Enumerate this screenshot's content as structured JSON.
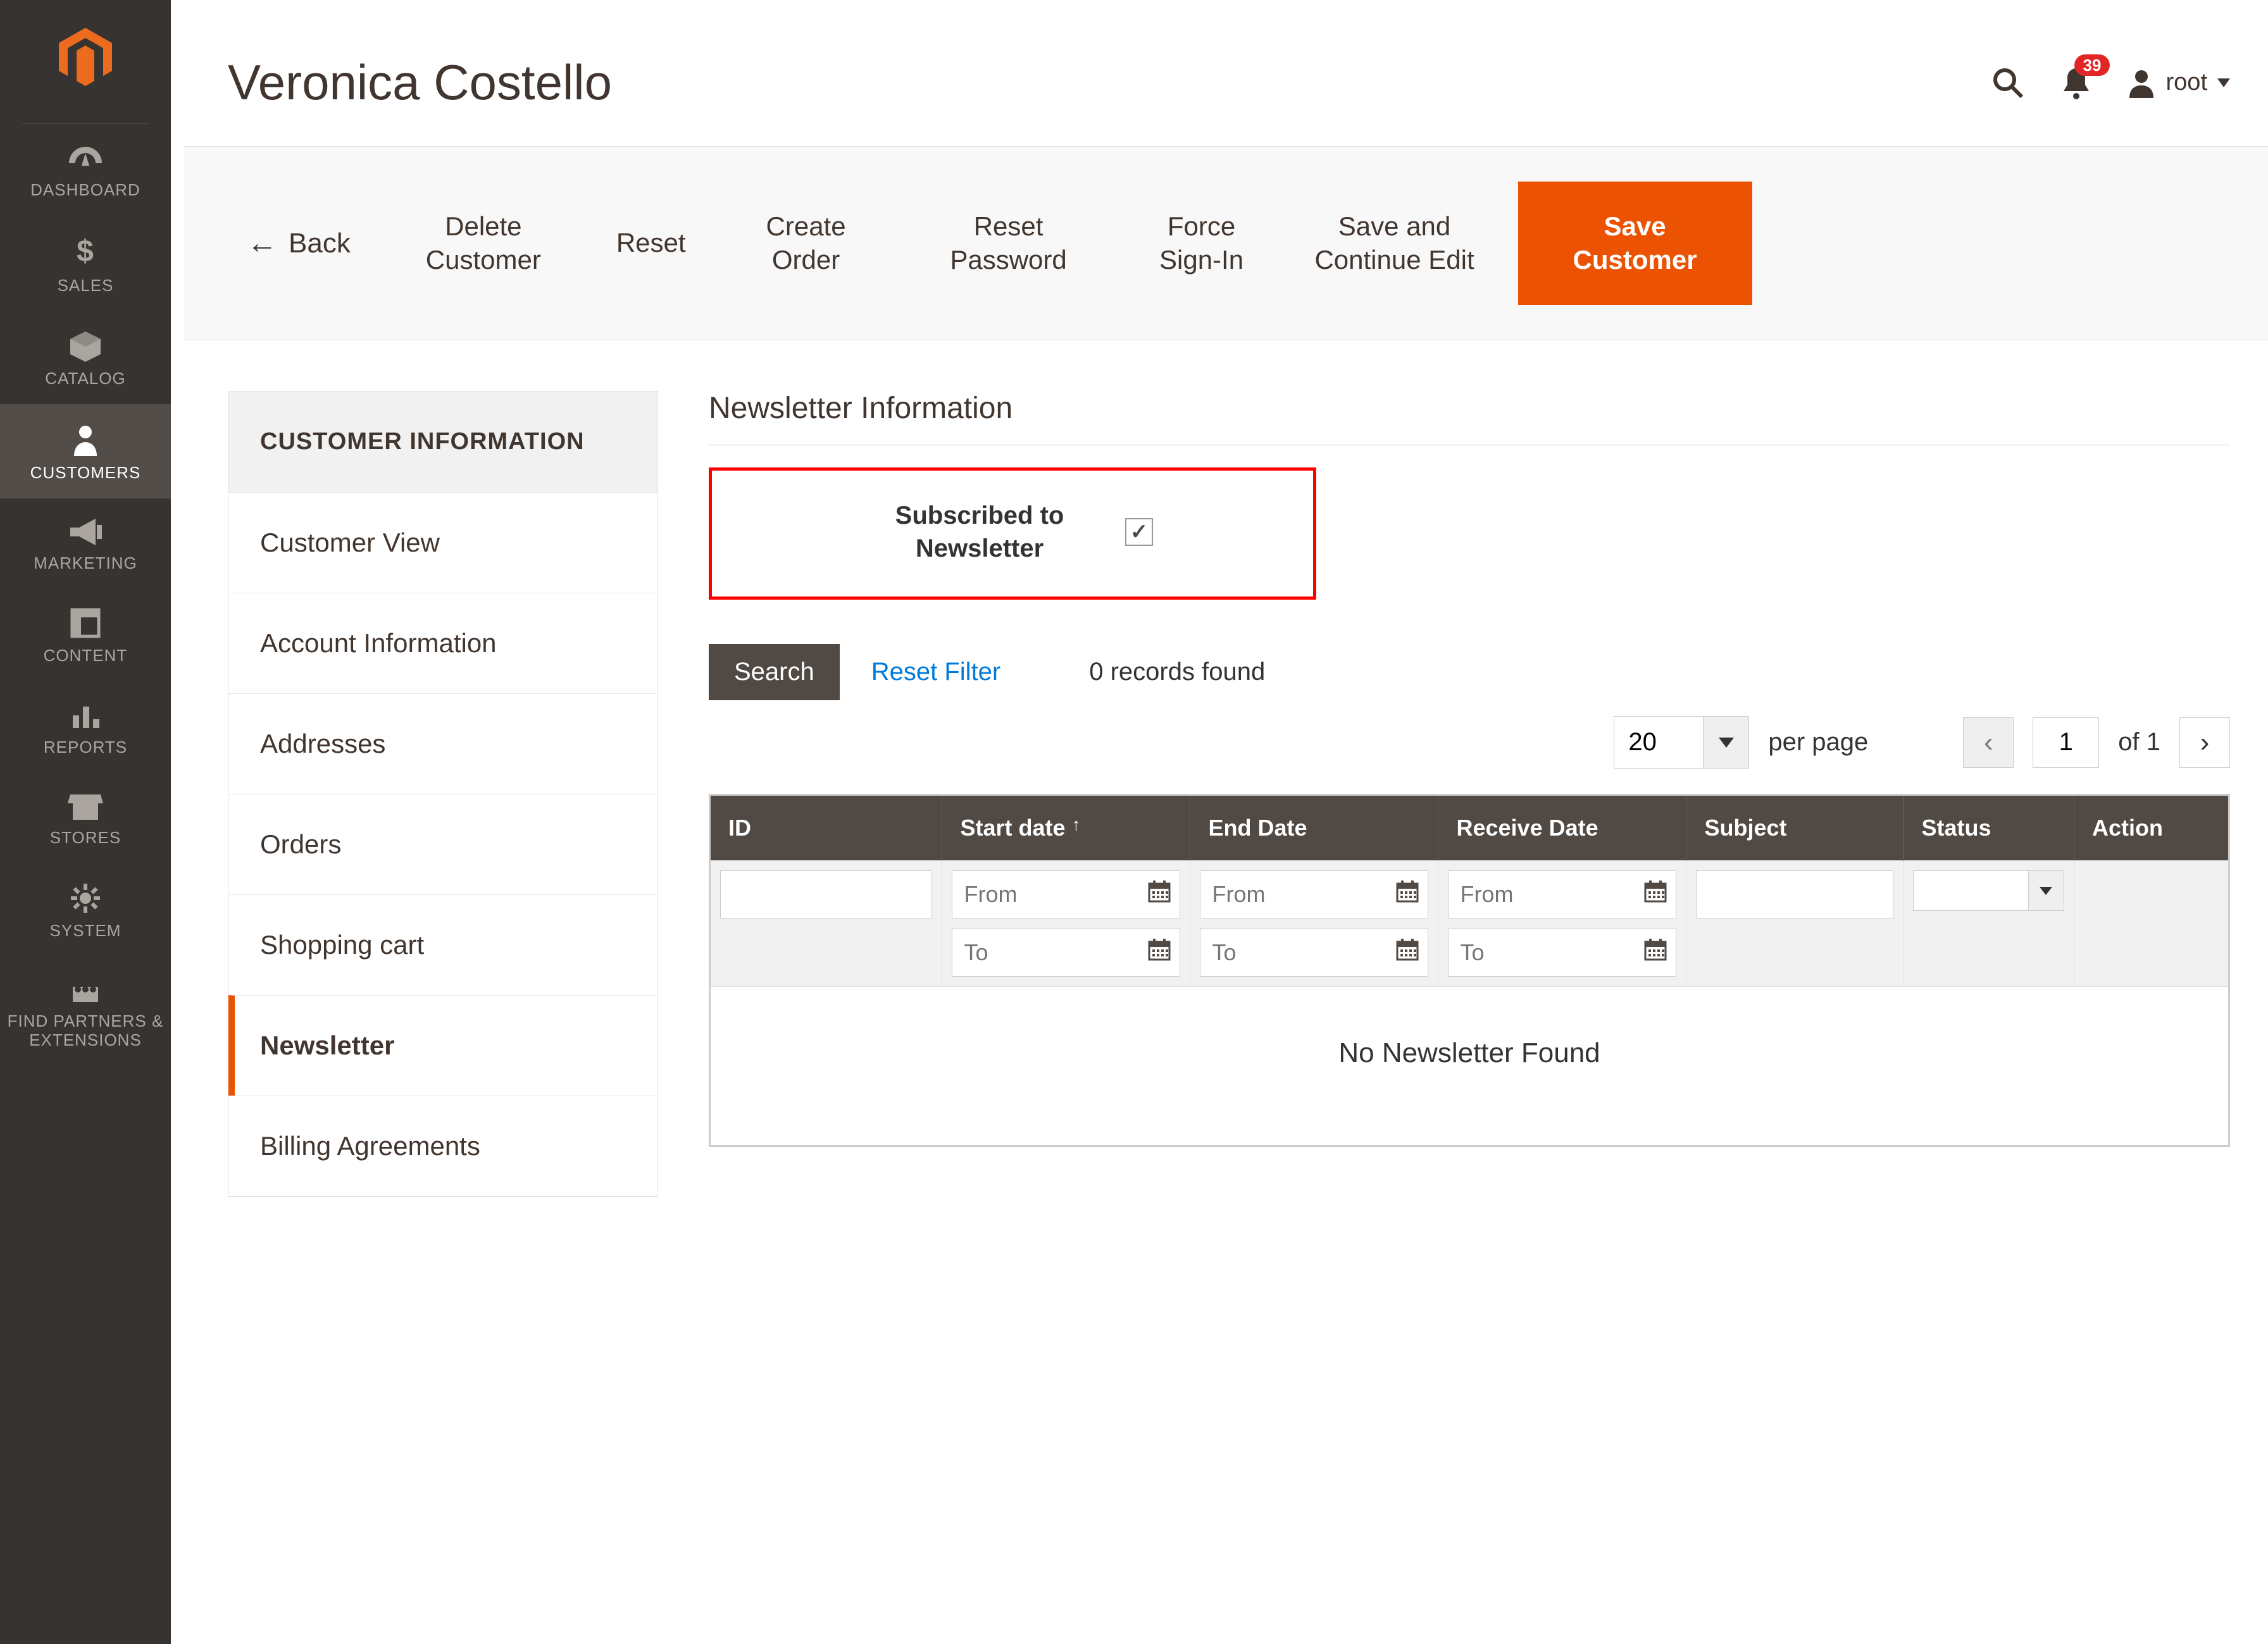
{
  "header": {
    "title": "Veronica Costello",
    "notifications": "39",
    "user": "root"
  },
  "sidebar": {
    "items": [
      {
        "label": "DASHBOARD",
        "icon": "dashboard"
      },
      {
        "label": "SALES",
        "icon": "sales"
      },
      {
        "label": "CATALOG",
        "icon": "catalog"
      },
      {
        "label": "CUSTOMERS",
        "icon": "customers"
      },
      {
        "label": "MARKETING",
        "icon": "marketing"
      },
      {
        "label": "CONTENT",
        "icon": "content"
      },
      {
        "label": "REPORTS",
        "icon": "reports"
      },
      {
        "label": "STORES",
        "icon": "stores"
      },
      {
        "label": "SYSTEM",
        "icon": "system"
      },
      {
        "label": "FIND PARTNERS & EXTENSIONS",
        "icon": "partners"
      }
    ]
  },
  "actions": {
    "back": "Back",
    "delete": "Delete Customer",
    "reset": "Reset",
    "create_order": "Create Order",
    "reset_password": "Reset Password",
    "force_signin": "Force Sign-In",
    "save_continue": "Save and Continue Edit",
    "save": "Save Customer"
  },
  "tabs_header": "CUSTOMER INFORMATION",
  "tabs": {
    "view": "Customer View",
    "account": "Account Information",
    "addresses": "Addresses",
    "orders": "Orders",
    "cart": "Shopping cart",
    "newsletter": "Newsletter",
    "billing": "Billing Agreements"
  },
  "section_title": "Newsletter Information",
  "field": {
    "subscribed_label": "Subscribed to Newsletter",
    "subscribed_checked": true
  },
  "filter": {
    "search": "Search",
    "reset": "Reset Filter",
    "records": "0 records found"
  },
  "pager": {
    "page_size": "20",
    "per_page": "per page",
    "page": "1",
    "of": "of 1"
  },
  "grid": {
    "cols": {
      "id": "ID",
      "start": "Start date",
      "end": "End Date",
      "receive": "Receive Date",
      "subject": "Subject",
      "status": "Status",
      "action": "Action"
    },
    "ph_from": "From",
    "ph_to": "To",
    "empty": "No Newsletter Found"
  }
}
